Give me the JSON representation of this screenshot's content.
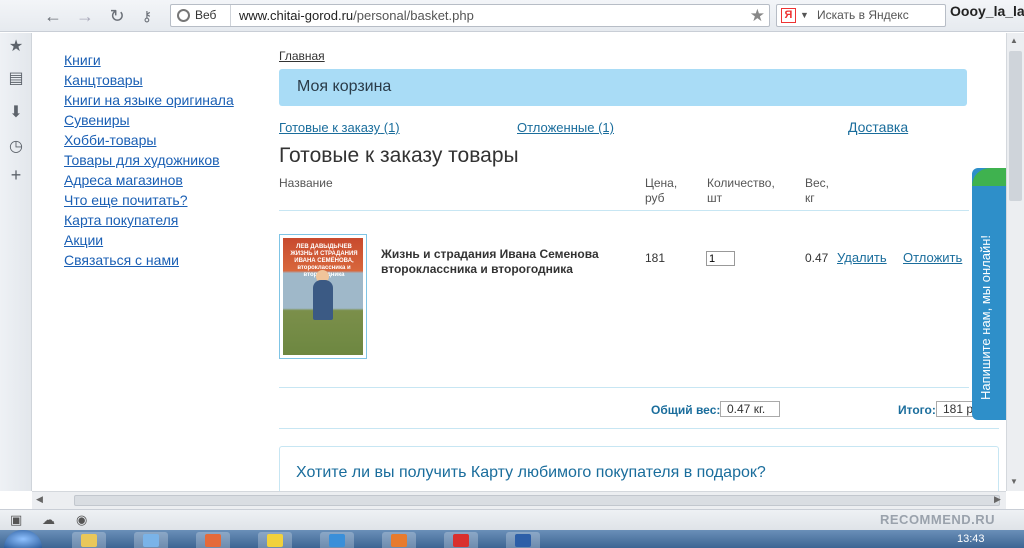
{
  "browser": {
    "search_engine_label": "Веб",
    "url_host": "www.chitai-gorod.ru",
    "url_path": "/personal/basket.php",
    "yandex_placeholder": "Искать в Яндекс",
    "user_name": "Oooy_la_la"
  },
  "sidebar": {
    "items": [
      {
        "label": "Книги"
      },
      {
        "label": "Канцтовары"
      },
      {
        "label": "Книги на языке оригинала"
      },
      {
        "label": "Сувениры"
      },
      {
        "label": "Хобби-товары"
      },
      {
        "label": "Товары для художников"
      },
      {
        "label": "Адреса магазинов"
      },
      {
        "label": "Что еще почитать?"
      },
      {
        "label": "Карта покупателя"
      },
      {
        "label": "Акции"
      },
      {
        "label": "Связаться с нами"
      }
    ]
  },
  "breadcrumb": "Главная",
  "banner_title": "Моя корзина",
  "tabs": {
    "ready": "Готовые к заказу",
    "ready_count": "(1)",
    "postponed": "Отложенные (1)",
    "delivery": "Доставка"
  },
  "section_title": "Готовые к заказу товары",
  "table": {
    "col_name": "Название",
    "col_price": "Цена,",
    "col_price_unit": "руб",
    "col_qty": "Количество,",
    "col_qty_unit": "шт",
    "col_weight": "Вес,",
    "col_weight_unit": "кг",
    "rows": [
      {
        "cover_title": "ЛЕВ ДАВЫДЫЧЕВ ЖИЗНЬ И СТРАДАНИЯ ИВАНА СЕМЁНОВА, второклассника и второгодника",
        "title": "Жизнь и страдания Ивана Семенова второклассника и второгодника",
        "price": "181",
        "qty": "1",
        "weight": "0.47",
        "delete_label": "Удалить",
        "postpone_label": "Отложить"
      }
    ]
  },
  "totals": {
    "weight_label": "Общий вес:",
    "weight_value": "0.47 кг.",
    "total_label": "Итого:",
    "total_value": "181 р"
  },
  "promo_text": "Хотите ли вы получить Карту любимого покупателя в подарок?",
  "chat_widget": "Напишите нам, мы онлайн!",
  "status_bar": {
    "watermark": "RECOMMEND.RU",
    "clock": "13:43"
  },
  "colors": {
    "link": "#1a5fb4",
    "banner": "#a9dcf6",
    "chat": "#2e8fc9"
  }
}
